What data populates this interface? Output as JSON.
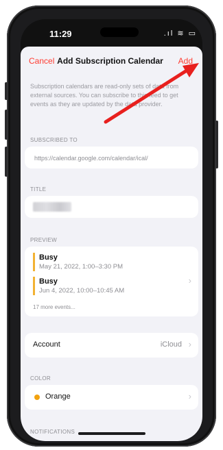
{
  "status": {
    "time": "11:29",
    "icons": ".ıl ≋ ▭"
  },
  "nav": {
    "cancel": "Cancel",
    "title": "Add Subscription Calendar",
    "add": "Add"
  },
  "info_text": "Subscription calendars are read-only sets of data from external sources. You can subscribe to this feed to get events as they are updated by the data provider.",
  "sections": {
    "subscribed_to": "SUBSCRIBED TO",
    "title": "TITLE",
    "preview": "PREVIEW",
    "color": "COLOR",
    "notifications": "NOTIFICATIONS"
  },
  "subscribed_url": "https://calendar.google.com/calendar/ical/",
  "preview": {
    "events": [
      {
        "title": "Busy",
        "date": "May 21, 2022, 1:00–3:30 PM"
      },
      {
        "title": "Busy",
        "date": "Jun 4, 2022, 10:00–10:45 AM"
      }
    ],
    "more": "17 more events..."
  },
  "account": {
    "label": "Account",
    "value": "iCloud"
  },
  "color": {
    "label": "Orange",
    "hex": "#f2a20f"
  },
  "accent": "#ff3b30",
  "icons": {
    "chevron": "chevron-right-icon",
    "arrow": "red-arrow-annotation"
  }
}
